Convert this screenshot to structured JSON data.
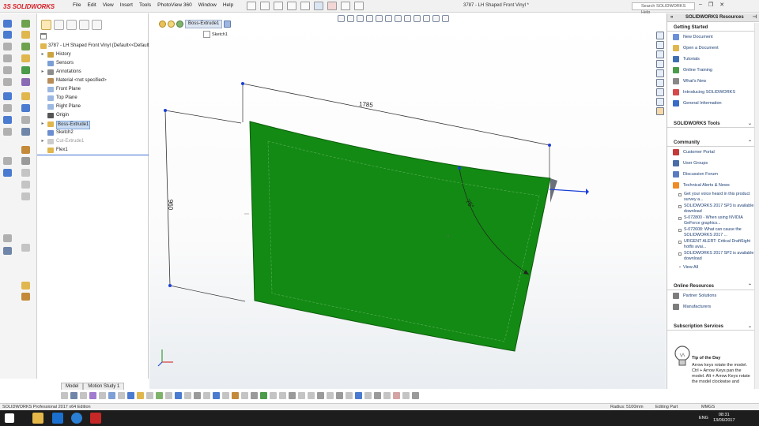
{
  "app": {
    "brand": "SOLIDWORKS",
    "brand_prefix": "3S",
    "menu": [
      "File",
      "Edit",
      "View",
      "Insert",
      "Tools",
      "PhotoView 360",
      "Window",
      "Help"
    ],
    "document_title": "3787 - LH Shaped Front Vinyl *",
    "search_placeholder": "Search SOLIDWORKS Help",
    "window_buttons": [
      "–",
      "❐",
      "✕"
    ]
  },
  "feature_tree": {
    "root": "3787 - LH Shaped Front Vinyl  (Default<<Default",
    "items": [
      {
        "label": "History",
        "expand": "▸",
        "indent": 1,
        "icon_color": "#c9a441"
      },
      {
        "label": "Sensors",
        "expand": "",
        "indent": 1,
        "icon_color": "#7b9fd4"
      },
      {
        "label": "Annotations",
        "expand": "▸",
        "indent": 1,
        "icon_color": "#8c8c8c"
      },
      {
        "label": "Material <not specified>",
        "expand": "",
        "indent": 1,
        "icon_color": "#b88d5a"
      },
      {
        "label": "Front Plane",
        "expand": "",
        "indent": 1,
        "icon_color": "#9bb7e2"
      },
      {
        "label": "Top Plane",
        "expand": "",
        "indent": 1,
        "icon_color": "#9bb7e2"
      },
      {
        "label": "Right Plane",
        "expand": "",
        "indent": 1,
        "icon_color": "#9bb7e2"
      },
      {
        "label": "Origin",
        "expand": "",
        "indent": 1,
        "icon_color": "#555555"
      },
      {
        "label": "Boss-Extrude1",
        "expand": "▸",
        "indent": 1,
        "icon_color": "#e0b64e",
        "selected": true
      },
      {
        "label": "Sketch2",
        "expand": "",
        "indent": 1,
        "icon_color": "#6a8ed0"
      },
      {
        "label": "Cut-Extrude1",
        "expand": "▸",
        "indent": 1,
        "icon_color": "#cccccc",
        "dim": true
      },
      {
        "label": "Flex1",
        "expand": "",
        "indent": 1,
        "icon_color": "#e0b64e"
      }
    ]
  },
  "bottom_tabs": [
    "Model",
    "Motion Study 1"
  ],
  "graphics": {
    "breadcrumb_active": "Boss-Extrude1",
    "breadcrumb_sketch": "Sketch1",
    "dimensions": {
      "width": "1785",
      "height": "960",
      "angle": "75°"
    },
    "colors": {
      "face": "#138a13",
      "edge": "#0b5c0b",
      "dim_line": "#1a1a1a",
      "arrow": "#1c3fd8"
    }
  },
  "task_pane": {
    "title": "SOLIDWORKS Resources",
    "getting_started": {
      "title": "Getting Started",
      "items": [
        {
          "label": "New Document",
          "icon_color": "#6b8fd8"
        },
        {
          "label": "Open a Document",
          "icon_color": "#e0b64e"
        },
        {
          "label": "Tutorials",
          "icon_color": "#3e6fb4"
        },
        {
          "label": "Online Training",
          "icon_color": "#4a9b4a"
        },
        {
          "label": "What's New",
          "icon_color": "#888888"
        },
        {
          "label": "Introducing SOLIDWORKS",
          "icon_color": "#d44a4a"
        },
        {
          "label": "General Information",
          "icon_color": "#3a6cc7"
        }
      ]
    },
    "tools": {
      "title": "SOLIDWORKS Tools"
    },
    "community": {
      "title": "Community",
      "items": [
        {
          "label": "Customer Portal",
          "icon_color": "#c33a3a"
        },
        {
          "label": "User Groups",
          "icon_color": "#4a6da8"
        },
        {
          "label": "Discussion Forum",
          "icon_color": "#5b7cc0"
        },
        {
          "label": "Technical Alerts & News",
          "icon_color": "#f08a24"
        }
      ],
      "news": [
        "Get your voice heard in this product survey a...",
        "SOLIDWORKS 2017 SP3 is available for download",
        "S-072800 - When using NVIDIA GeForce graphics...",
        "S-072608: What can cause the SOLIDWORKS 2017 ...",
        "URGENT ALERT: Critical DraftSight hotfix avai...",
        "SOLIDWORKS 2017 SP2 is available for download"
      ],
      "view_all": "View All"
    },
    "online_resources": {
      "title": "Online Resources",
      "items": [
        {
          "label": "Partner Solutions",
          "icon_color": "#7d7d7d"
        },
        {
          "label": "Manufacturers",
          "icon_color": "#7d7d7d"
        }
      ]
    },
    "subscription": {
      "title": "Subscription Services"
    },
    "tip": {
      "title": "Tip of the Day",
      "text": "Arrow keys rotate the model. Ctrl + Arrow Keys pan the model. Alt + Arrow Keys rotate the model clockwise and"
    }
  },
  "status_bar": {
    "edition": "SOLIDWORKS Professional 2017 x64 Edition",
    "radius": "Radius: 5100mm",
    "mode": "Editing Part",
    "units": "MMGS"
  },
  "taskbar": {
    "lang": "ENG",
    "time": "08:31",
    "date": "13/06/2017"
  }
}
